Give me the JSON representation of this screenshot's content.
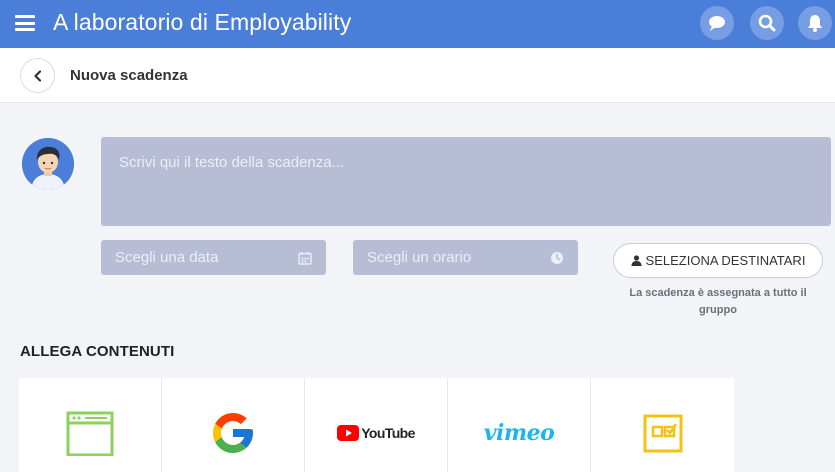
{
  "header": {
    "title": "A laboratorio di Employability",
    "bg_color": "#4a7ed9",
    "icons": [
      "chat-icon",
      "search-icon",
      "bell-icon"
    ]
  },
  "subheader": {
    "back_icon": "chevron-left-icon",
    "title": "Nuova scadenza"
  },
  "form": {
    "text_placeholder": "Scrivi qui il testo della scadenza...",
    "date_placeholder": "Scegli una data",
    "date_icon": "calendar-icon",
    "time_placeholder": "Scegli un orario",
    "time_icon": "clock-icon",
    "recipients_label": "SELEZIONA DESTINATARI",
    "recipients_icon": "user-icon",
    "recipients_note": "La scadenza è assegnata a tutto il gruppo"
  },
  "attach": {
    "title": "ALLEGA CONTENUTI",
    "tiles": [
      {
        "name": "web-page",
        "icon": "browser-window-icon"
      },
      {
        "name": "google",
        "icon": "google-icon"
      },
      {
        "name": "youtube",
        "label": "YouTube",
        "icon": "youtube-icon"
      },
      {
        "name": "vimeo",
        "label": "vimeo",
        "icon": "vimeo-logo"
      },
      {
        "name": "quiz",
        "icon": "checkbox-icon"
      }
    ]
  }
}
